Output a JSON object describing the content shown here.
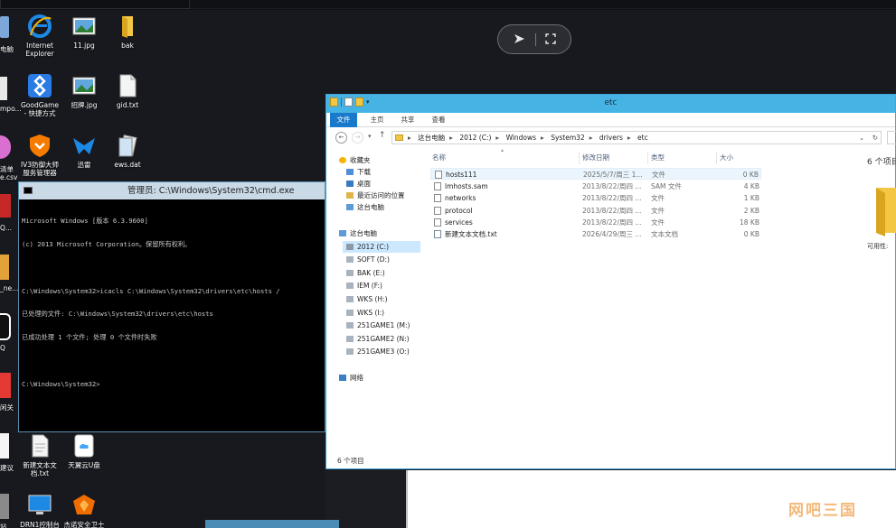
{
  "remote_toolbar": {
    "play_icon": "play-arrow-icon",
    "fullscreen_icon": "fullscreen-icon"
  },
  "desktop": {
    "icons": [
      {
        "label1": "Internet",
        "label2": "Explorer",
        "icon": "ie-icon"
      },
      {
        "label1": "11.jpg",
        "label2": "",
        "icon": "image-icon"
      },
      {
        "label1": "bak",
        "label2": "",
        "icon": "folder-icon"
      },
      {
        "label1": "GoodGame",
        "label2": "- 快捷方式",
        "icon": "goodgame-icon"
      },
      {
        "label1": "招牌.jpg",
        "label2": "",
        "icon": "image-icon"
      },
      {
        "label1": "gid.txt",
        "label2": "",
        "icon": "text-file-icon"
      },
      {
        "label1": "IV3防御大师",
        "label2": "服务管理器",
        "icon": "shield-icon"
      },
      {
        "label1": "迅雷",
        "label2": "",
        "icon": "thunder-icon"
      },
      {
        "label1": "ews.dat",
        "label2": "",
        "icon": "dat-file-icon"
      },
      {
        "label1": "新建文本文",
        "label2": "档.txt",
        "icon": "text-file-icon"
      },
      {
        "label1": "天翼云U盘",
        "label2": "",
        "icon": "cloud-disk-icon"
      },
      {
        "label1": "DRN1控制台",
        "label2": "",
        "icon": "monitor-icon"
      },
      {
        "label1": "杰诺安全卫士",
        "label2": "",
        "icon": "security-guard-icon"
      }
    ],
    "partial_labels": [
      "电脑",
      "mpo...",
      "清单",
      "e.csv",
      "Q...",
      "_ne...",
      "Q",
      "闲关",
      "建议",
      "站"
    ]
  },
  "cmd": {
    "title": "管理员: C:\\Windows\\System32\\cmd.exe",
    "lines": [
      "Microsoft Windows [版本 6.3.9600]",
      "(c) 2013 Microsoft Corporation。保留所有权利。",
      "",
      "C:\\Windows\\System32>icacls C:\\Windows\\System32\\drivers\\etc\\hosts /",
      "已处理的文件: C:\\Windows\\System32\\drivers\\etc\\hosts",
      "已成功处理 1 个文件; 处理 0 个文件时失败",
      "",
      "C:\\Windows\\System32>"
    ]
  },
  "explorer": {
    "title": "etc",
    "tabs": [
      "文件",
      "主页",
      "共享",
      "查看"
    ],
    "address": [
      "这台电脑",
      "2012 (C:)",
      "Windows",
      "System32",
      "drivers",
      "etc"
    ],
    "address_chevron": "⌄",
    "refresh": "↻",
    "nav": [
      {
        "label": "收藏夹",
        "icon": "star-icon",
        "indent": 0
      },
      {
        "label": "下载",
        "icon": "download-folder-icon",
        "indent": 1
      },
      {
        "label": "桌面",
        "icon": "desktop-folder-icon",
        "indent": 1
      },
      {
        "label": "最近访问的位置",
        "icon": "recent-icon",
        "indent": 1
      },
      {
        "label": "这台电脑",
        "icon": "computer-icon",
        "indent": 1
      },
      {
        "label": "这台电脑",
        "icon": "computer-icon",
        "indent": 0
      },
      {
        "label": "2012 (C:)",
        "icon": "drive-icon",
        "indent": 1,
        "selected": true
      },
      {
        "label": "SOFT (D:)",
        "icon": "drive-icon",
        "indent": 1
      },
      {
        "label": "BAK (E:)",
        "icon": "drive-icon",
        "indent": 1
      },
      {
        "label": "IEM (F:)",
        "icon": "drive-icon",
        "indent": 1
      },
      {
        "label": "WKS (H:)",
        "icon": "drive-icon",
        "indent": 1
      },
      {
        "label": "WKS (I:)",
        "icon": "drive-icon",
        "indent": 1
      },
      {
        "label": "251GAME1 (M:)",
        "icon": "drive-icon",
        "indent": 1
      },
      {
        "label": "251GAME2 (N:)",
        "icon": "drive-icon",
        "indent": 1
      },
      {
        "label": "251GAME3 (O:)",
        "icon": "drive-icon",
        "indent": 1
      },
      {
        "label": "网络",
        "icon": "network-icon",
        "indent": 0
      }
    ],
    "columns": [
      "名称",
      "修改日期",
      "类型",
      "大小"
    ],
    "files": [
      {
        "name": "hosts111",
        "date": "2025/5/7/周三 1...",
        "type": "文件",
        "size": "0 KB",
        "selected": true
      },
      {
        "name": "lmhosts.sam",
        "date": "2013/8/22/周四 ...",
        "type": "SAM 文件",
        "size": "4 KB"
      },
      {
        "name": "networks",
        "date": "2013/8/22/周四 ...",
        "type": "文件",
        "size": "1 KB"
      },
      {
        "name": "protocol",
        "date": "2013/8/22/周四 ...",
        "type": "文件",
        "size": "2 KB"
      },
      {
        "name": "services",
        "date": "2013/8/22/周四 ...",
        "type": "文件",
        "size": "18 KB"
      },
      {
        "name": "新建文本文档.txt",
        "date": "2026/4/29/周三 ...",
        "type": "文本文档",
        "size": "0 KB"
      }
    ],
    "status": "6 个项目",
    "right_panel_title": "6 个项目",
    "right_panel_caption": "可用性:"
  },
  "watermark": "网吧三国"
}
